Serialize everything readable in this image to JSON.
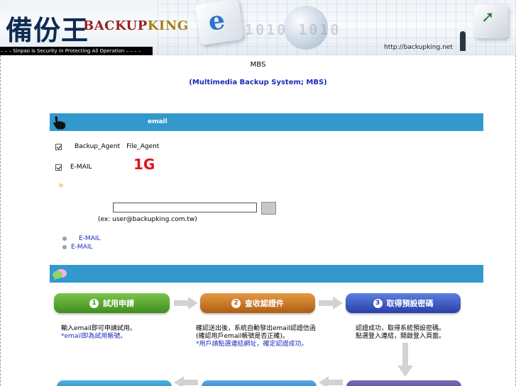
{
  "header": {
    "logo_cn": "備份王",
    "logo_en_part1": "BACKUP",
    "logo_en_part2": "KING",
    "tagline": "– – – Sinpao is Security In Protecting All Operation – – – –",
    "url": "http://backupking.net",
    "binary_decor": "01010  1010"
  },
  "intro": {
    "line1": "MBS",
    "line2": "(Multimedia Backup System; MBS)"
  },
  "section1": {
    "title": "email",
    "icon": "pointing-hand-icon"
  },
  "options": {
    "item1_a": "Backup_Agent",
    "item1_b": "File_Agent",
    "item2": "E-MAIL",
    "highlight": "1G",
    "small_icon": "ilı"
  },
  "email_form": {
    "value": "",
    "placeholder": "",
    "example": "(ex: user@backupking.com.tw)",
    "submit_label": ""
  },
  "links": [
    "E-MAIL",
    "E-MAIL"
  ],
  "section2": {
    "title": "",
    "icon": "chat-bubbles-icon"
  },
  "steps": [
    {
      "number": "1",
      "label": "試用申請",
      "desc_lines": [
        "輸入email即可申請試用。"
      ],
      "desc_blue_lines": [
        "*email即為試用帳號。"
      ]
    },
    {
      "number": "2",
      "label": "查收認證件",
      "desc_lines": [
        "確認送出後，系統自動發出email認證信函",
        "(確認用戶email帳號是否正確)。"
      ],
      "desc_blue_lines": [
        "*用戶請點選連結網址，確定認證成功。"
      ]
    },
    {
      "number": "3",
      "label": "取得預設密碼",
      "desc_lines": [
        "認證成功，取得系統預設密碼。",
        "點選登入連結，開啟登入頁面。"
      ],
      "desc_blue_lines": []
    }
  ],
  "colors": {
    "section_bar": "#3399cc",
    "link_blue": "#1c2bb8",
    "highlight_red": "#e0121d",
    "step1": "#4e9e2a",
    "step2": "#c66e1c",
    "step3": "#3550c0"
  }
}
